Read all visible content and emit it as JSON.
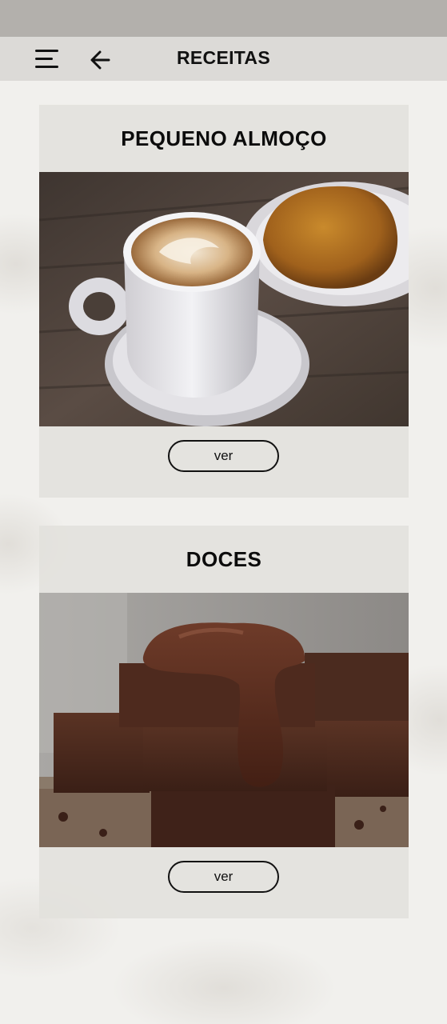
{
  "header": {
    "title": "RECEITAS",
    "menu_icon": "hamburger-menu-icon",
    "back_icon": "arrow-left-icon"
  },
  "cards": [
    {
      "title": "PEQUENO ALMOÇO",
      "image": "coffee-and-pastry-photo",
      "button_label": "ver"
    },
    {
      "title": "DOCES",
      "image": "chocolate-brownies-photo",
      "button_label": "ver"
    }
  ],
  "colors": {
    "status_bar": "#b3b0ac",
    "app_bar": "#dcdad7",
    "card": "#e2e0dc",
    "text": "#111111"
  }
}
